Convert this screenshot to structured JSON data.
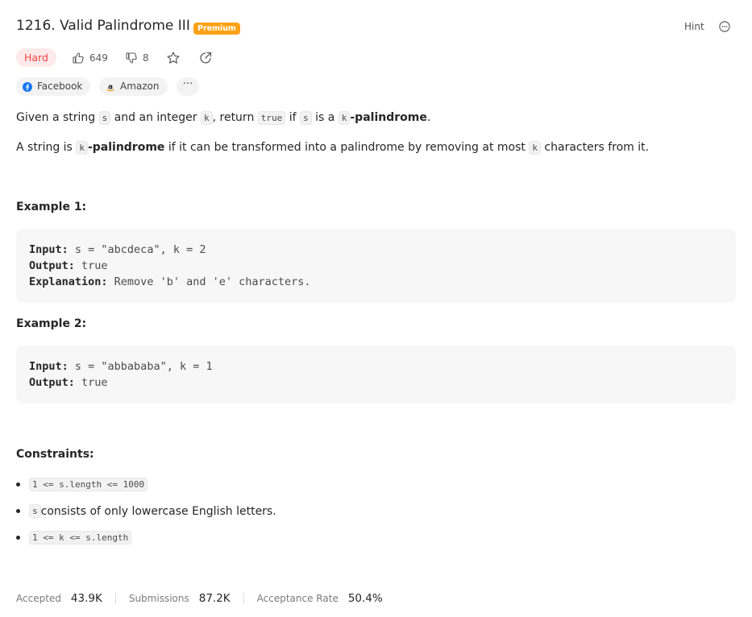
{
  "header": {
    "title": "1216. Valid Palindrome III",
    "premium_badge": "Premium",
    "hint_label": "Hint",
    "more_icon": "more-horizontal-circle-icon"
  },
  "meta": {
    "difficulty": "Hard",
    "likes": "649",
    "dislikes": "8",
    "difficulty_color": "#ef4743",
    "premium_color": "#ffa116"
  },
  "companies": {
    "items": [
      "Facebook",
      "Amazon"
    ],
    "more_label": "···"
  },
  "description": {
    "line1": {
      "pre": "Given a string ",
      "code1": "s",
      "mid1": " and an integer ",
      "code2": "k",
      "mid2": ", return ",
      "code3": "true",
      "mid3": " if ",
      "code4": "s",
      "mid4": " is a ",
      "code5": "k",
      "bold": "-palindrome",
      "end": "."
    },
    "line2": {
      "pre": "A string is ",
      "code1": "k",
      "bold": "-palindrome",
      "mid": " if it can be transformed into a palindrome by removing at most ",
      "code2": "k",
      "end": " characters from it."
    }
  },
  "examples": [
    {
      "heading": "Example 1:",
      "input_label": "Input:",
      "input_value": " s = \"abcdeca\", k = 2",
      "output_label": "Output:",
      "output_value": " true",
      "explanation_label": "Explanation:",
      "explanation_value": " Remove 'b' and 'e' characters."
    },
    {
      "heading": "Example 2:",
      "input_label": "Input:",
      "input_value": " s = \"abbababa\", k = 1",
      "output_label": "Output:",
      "output_value": " true"
    }
  ],
  "constraints": {
    "heading": "Constraints:",
    "c1_code": "1 <= s.length <= 1000",
    "c2_code": "s",
    "c2_text": " consists of only lowercase English letters.",
    "c3_code": "1 <= k <= s.length"
  },
  "footer": {
    "accepted_label": "Accepted",
    "accepted_value": "43.9K",
    "submissions_label": "Submissions",
    "submissions_value": "87.2K",
    "rate_label": "Acceptance Rate",
    "rate_value": "50.4%"
  }
}
